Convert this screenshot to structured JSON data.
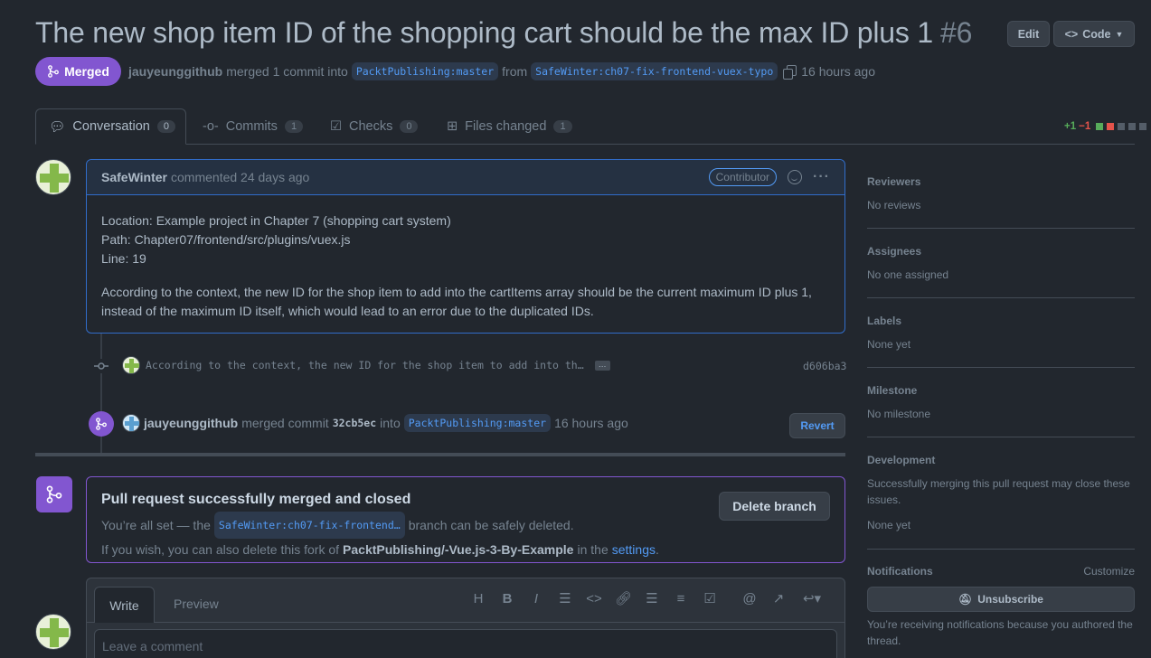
{
  "header": {
    "title": "The new shop item ID of the shopping cart should be the max ID plus 1",
    "number": "#6",
    "edit_label": "Edit",
    "code_label": "Code"
  },
  "status": {
    "badge": "Merged",
    "author": "jauyeunggithub",
    "merged_text": "merged 1 commit into",
    "base_branch": "PacktPublishing:master",
    "from_text": "from",
    "head_branch": "SafeWinter:ch07-fix-frontend-vuex-typo",
    "time": "16 hours ago"
  },
  "tabs": [
    {
      "label": "Conversation",
      "count": "0"
    },
    {
      "label": "Commits",
      "count": "1"
    },
    {
      "label": "Checks",
      "count": "0"
    },
    {
      "label": "Files changed",
      "count": "1"
    }
  ],
  "diffstat": {
    "add": "+1",
    "del": "−1"
  },
  "comment": {
    "author": "SafeWinter",
    "time": "commented 24 days ago",
    "badge": "Contributor",
    "line1": "Location: Example project in Chapter 7 (shopping cart system)",
    "line2": "Path: Chapter07/frontend/src/plugins/vuex.js",
    "line3": "Line: 19",
    "para": "According to the context, the new ID for the shop item to add into the cartItems array should be the current maximum ID plus 1, instead of the maximum ID itself, which would lead to an error due to the duplicated IDs."
  },
  "commit": {
    "message": "According to the context, the new ID for the shop item to add into th…",
    "ellipsis": "…",
    "sha": "d606ba3"
  },
  "merge_event": {
    "author": "jauyeunggithub",
    "text1": "merged commit",
    "sha": "32cb5ec",
    "text2": "into",
    "branch": "PacktPublishing:master",
    "time": "16 hours ago",
    "revert_label": "Revert"
  },
  "merged_box": {
    "title": "Pull request successfully merged and closed",
    "line1_pre": "You’re all set — the",
    "branch": "SafeWinter:ch07-fix-frontend…",
    "line1_post": "branch can be safely deleted.",
    "line2_pre": "If you wish, you can also delete this fork of",
    "repo": "PacktPublishing/-Vue.js-3-By-Example",
    "line2_mid": "in the",
    "settings": "settings",
    "line2_end": ".",
    "delete_label": "Delete branch"
  },
  "editor": {
    "write_tab": "Write",
    "preview_tab": "Preview",
    "placeholder": "Leave a comment",
    "toolbar": [
      "H",
      "B",
      "I",
      "quote",
      "code",
      "link",
      "ul",
      "ol",
      "task",
      "mention",
      "ref",
      "reply"
    ]
  },
  "sidebar": {
    "reviewers": {
      "title": "Reviewers",
      "value": "No reviews"
    },
    "assignees": {
      "title": "Assignees",
      "value": "No one assigned"
    },
    "labels": {
      "title": "Labels",
      "value": "None yet"
    },
    "milestone": {
      "title": "Milestone",
      "value": "No milestone"
    },
    "development": {
      "title": "Development",
      "desc": "Successfully merging this pull request may close these issues.",
      "value": "None yet"
    },
    "notifications": {
      "title": "Notifications",
      "customize": "Customize",
      "unsubscribe": "Unsubscribe",
      "note": "You’re receiving notifications because you authored the thread."
    }
  },
  "colors": {
    "merged": "#8256d0",
    "accent": "#539bf5",
    "add": "#57ab5a",
    "del": "#e5534b"
  }
}
